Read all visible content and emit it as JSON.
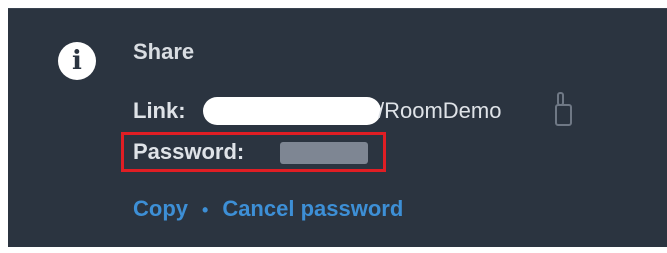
{
  "share": {
    "title": "Share",
    "link_label": "Link:",
    "link_suffix": "/RoomDemo",
    "password_label": "Password:",
    "copy_label": "Copy",
    "separator": "•",
    "cancel_password_label": "Cancel password"
  },
  "icons": {
    "info": "info-icon",
    "clipboard": "clipboard-icon"
  },
  "colors": {
    "panel_bg": "#2b3440",
    "link_color": "#3d8fd6",
    "highlight_border": "#e01e24"
  }
}
